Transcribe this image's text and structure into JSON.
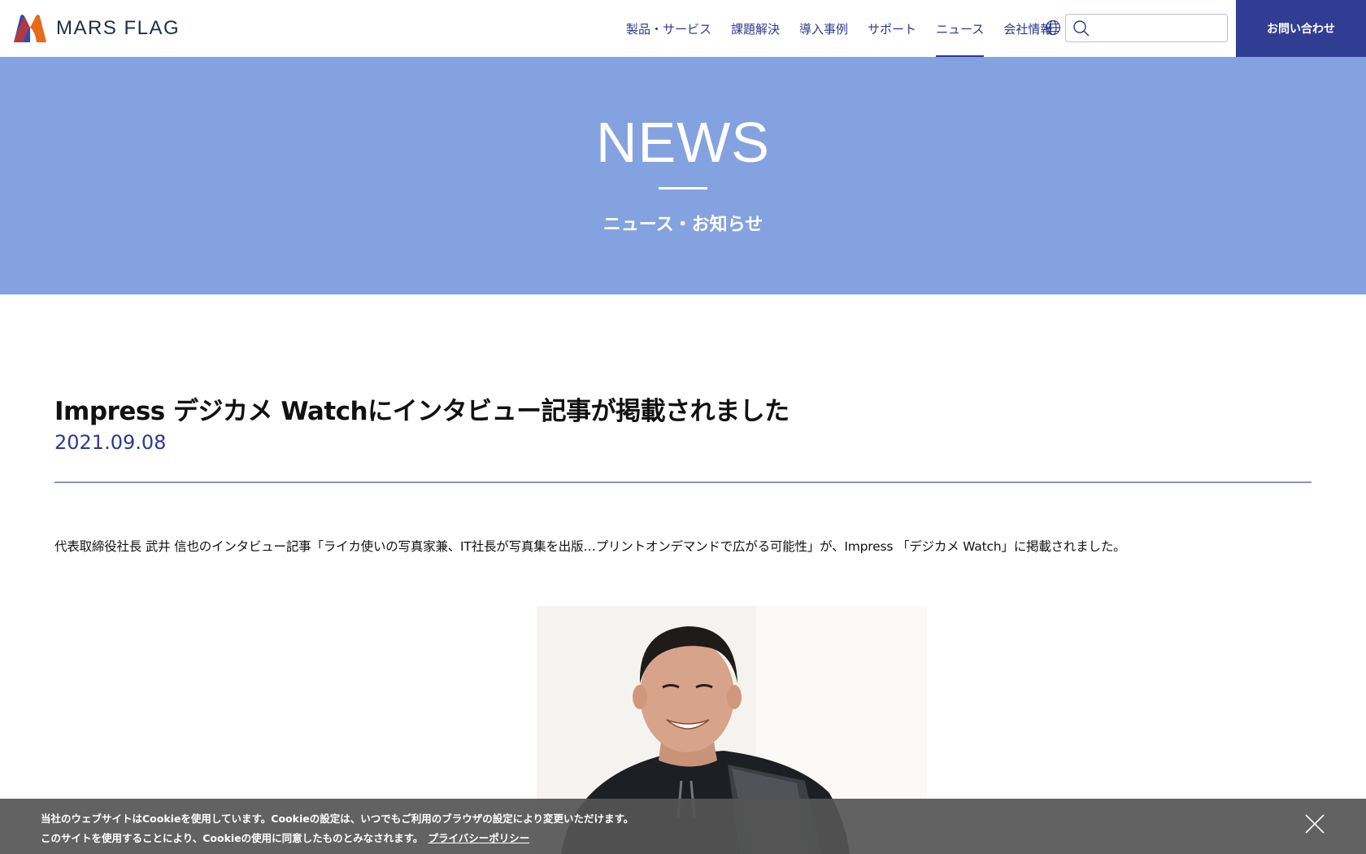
{
  "header": {
    "logo_text": "MARS FLAG",
    "nav": [
      {
        "label": "製品・サービス"
      },
      {
        "label": "課題解決"
      },
      {
        "label": "導入事例"
      },
      {
        "label": "サポート"
      },
      {
        "label": "ニュース",
        "active": true
      },
      {
        "label": "会社情報"
      }
    ],
    "search_placeholder": "",
    "search_value": "",
    "contact_label": "お問い合わせ",
    "icons": {
      "globe": "globe-icon",
      "search": "search-icon"
    }
  },
  "hero": {
    "title": "NEWS",
    "subtitle": "ニュース・お知らせ"
  },
  "article": {
    "title": "Impress デジカメ Watchにインタビュー記事が掲載されました",
    "date": "2021.09.08",
    "body": "代表取締役社長 武井 信也のインタビュー記事「ライカ使いの写真家兼、IT社長が写真集を出版…プリントオンデマンドで広がる可能性」が、Impress 「デジカメ Watch」に掲載されました。"
  },
  "cookie": {
    "line1": "当社のウェブサイトはCookieを使用しています。Cookieの設定は、いつでもご利用のブラウザの設定により変更いただけます。",
    "line2": "このサイトを使用することにより、Cookieの使用に同意したものとみなされます。",
    "link_label": "プライバシーポリシー"
  },
  "colors": {
    "brand": "#303d93",
    "nav_text": "#2b3a8f",
    "hero_bg": "#83a2df",
    "divider": "#8e92c8",
    "cookie_bg": "#555555"
  }
}
